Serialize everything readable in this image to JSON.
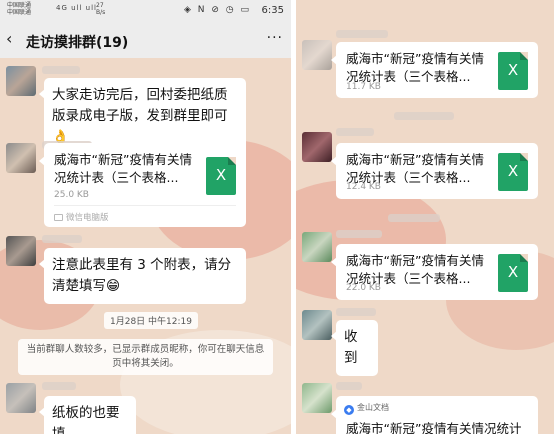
{
  "status_bar": {
    "carrier_line1": "中国联通",
    "carrier_line2": "中国联通",
    "network": "4G ull ull",
    "speed_value": "27",
    "speed_unit": "B/s",
    "right_icons": "◈ N ⊘ ◷ ▭",
    "time": "6:35"
  },
  "header": {
    "title": "走访摸排群(19)",
    "back_glyph": "‹",
    "more_glyph": "···"
  },
  "left_messages": {
    "msg1": "大家走访完后，回村委把纸质版录成电子版，发到群里即可👌",
    "file1": {
      "name_line1": "威海市“新冠”疫情有关情",
      "name_line2": "况统计表（三个表格...",
      "size": "25.0 KB",
      "source": "微信电脑版"
    },
    "msg2": "注意此表里有 3 个附表，请分清楚填写😁",
    "time_chip": "1月28日 中午12:19",
    "system_notice": "当前群聊人数较多，已显示群成员昵称，你可在聊天信息页中将其关闭。",
    "msg3": "纸板的也要填"
  },
  "right_messages": {
    "file_a": {
      "name_line1": "威海市“新冠”疫情有关情",
      "name_line2": "况统计表（三个表格...",
      "size": "11.7 KB"
    },
    "file_b": {
      "name_line1": "威海市“新冠”疫情有关情",
      "name_line2": "况统计表（三个表格...",
      "size": "12.4 KB"
    },
    "file_c": {
      "name_line1": "威海市“新冠”疫情有关情",
      "name_line2": "况统计表（三个表格...",
      "size": "22.0 KB"
    },
    "msg_received": "收到",
    "doc_card": {
      "source": "金山文档",
      "title": "威海市“新冠”疫情有关情况统计"
    }
  },
  "icons": {
    "excel_glyph": "X"
  },
  "colors": {
    "chat_background": "#efd9c8",
    "bar_background": "#ededed",
    "bubble": "#ffffff",
    "excel_green": "#21a366",
    "doc_blue": "#3a7cf0"
  }
}
